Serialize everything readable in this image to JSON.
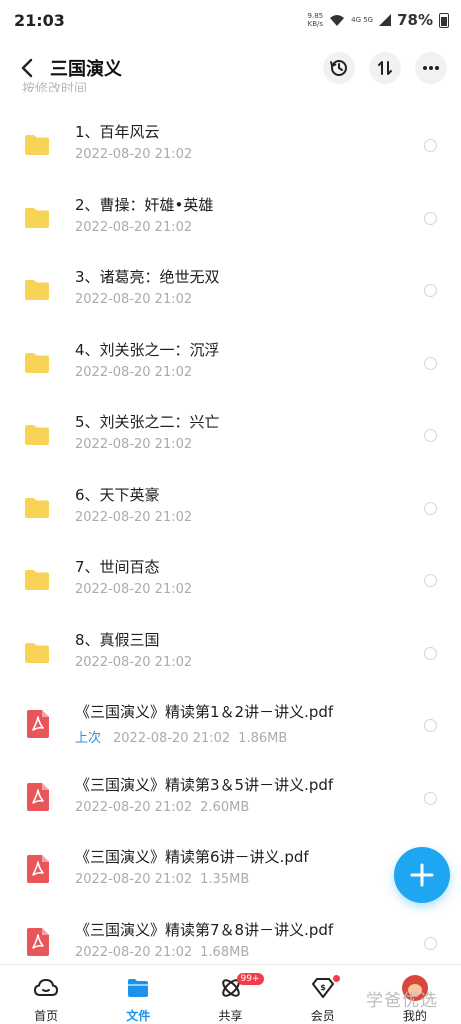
{
  "status": {
    "time": "21:03",
    "net_speed": "9.85",
    "net_unit": "KB/s",
    "network_types": "4G 5G",
    "battery": "78%"
  },
  "header": {
    "title": "三国演义",
    "icons": [
      "back-icon",
      "history-icon",
      "sort-icon",
      "more-icon"
    ]
  },
  "list": {
    "partial_label": "按修改时间",
    "items": [
      {
        "type": "folder",
        "name": "1、百年风云",
        "date": "2022-08-20  21:02"
      },
      {
        "type": "folder",
        "name": "2、曹操：奸雄•英雄",
        "date": "2022-08-20  21:02"
      },
      {
        "type": "folder",
        "name": "3、诸葛亮：绝世无双",
        "date": "2022-08-20  21:02"
      },
      {
        "type": "folder",
        "name": "4、刘关张之一：沉浮",
        "date": "2022-08-20  21:02"
      },
      {
        "type": "folder",
        "name": "5、刘关张之二：兴亡",
        "date": "2022-08-20  21:02"
      },
      {
        "type": "folder",
        "name": "6、天下英豪",
        "date": "2022-08-20  21:02"
      },
      {
        "type": "folder",
        "name": "7、世间百态",
        "date": "2022-08-20  21:02"
      },
      {
        "type": "folder",
        "name": "8、真假三国",
        "date": "2022-08-20  21:02"
      },
      {
        "type": "pdf",
        "name": "《三国演义》精读第1＆2讲－讲义.pdf",
        "tag": "上次",
        "date": "2022-08-20  21:02",
        "size": "1.86MB"
      },
      {
        "type": "pdf",
        "name": "《三国演义》精读第3＆5讲－讲义.pdf",
        "date": "2022-08-20  21:02",
        "size": "2.60MB"
      },
      {
        "type": "pdf",
        "name": "《三国演义》精读第6讲－讲义.pdf",
        "date": "2022-08-20  21:02",
        "size": "1.35MB"
      },
      {
        "type": "pdf",
        "name": "《三国演义》精读第7＆8讲－讲义.pdf",
        "date": "2022-08-20  21:02",
        "size": "1.68MB"
      }
    ]
  },
  "fab": {
    "icon": "plus-icon"
  },
  "tabbar": {
    "tabs": [
      {
        "label": "首页",
        "icon": "home-cloud-icon",
        "active": false
      },
      {
        "label": "文件",
        "icon": "files-icon",
        "active": true
      },
      {
        "label": "共享",
        "icon": "share-atom-icon",
        "active": false,
        "badge": "99+"
      },
      {
        "label": "会员",
        "icon": "vip-diamond-icon",
        "active": false,
        "dot": true
      },
      {
        "label": "我的",
        "icon": "avatar-icon",
        "active": false
      }
    ]
  },
  "watermark": "学爸优选",
  "colors": {
    "accent": "#1c92e8",
    "fab": "#1fa6f2",
    "folder": "#f7d356",
    "pdf": "#e8565a",
    "badge": "#f23c4c"
  }
}
